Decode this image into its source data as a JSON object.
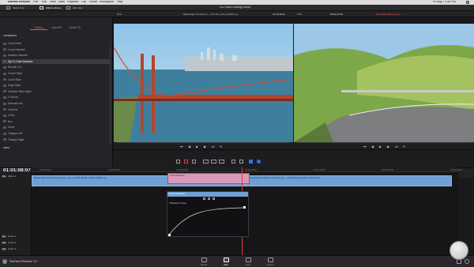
{
  "menubar": {
    "app": "DaVinci Resolve",
    "items": [
      "File",
      "Edit",
      "View",
      "Mark",
      "Playback",
      "Clip",
      "Nodes",
      "Workspace",
      "Help"
    ],
    "clock": "Fri Aug 7  4:44 PM"
  },
  "window": {
    "title": "912 NAB Editing Demo",
    "left_tabs": [
      "Media Pool",
      "Effects Library",
      "Edit Index"
    ]
  },
  "source_viewer": {
    "zoom": "57%",
    "clip_name": "Blackmagic Production ...2-03-19_1426_C0005.mov",
    "timecode": "14:26:30:01"
  },
  "program_viewer": {
    "zoom": "57%",
    "timecode": "00:03:19:19",
    "timeline_name": "912 NAB Editing Demo"
  },
  "effects": {
    "tabs": [
      "Toolbox",
      "OpenFX",
      "Audio FX"
    ],
    "section": "Transitions",
    "items": [
      "Cross Fade",
      "Cross Dissolve",
      "Additive Dissolve",
      "Dip To Color Dissolve",
      "Smooth Cut",
      "Center Wipe",
      "Clock Wipe",
      "Edge Wipe",
      "Venetian Blind Wipe",
      "X Iris Iris",
      "Diamond Iris",
      "Oval Iris",
      "X Box",
      "Box",
      "Heart",
      "Triangle Left",
      "Triangle Right"
    ],
    "selected_index": 3,
    "footer": "Titles"
  },
  "timeline": {
    "timecode": "01:01:08:07",
    "ruler_ticks": [
      "01:00:00:00",
      "01:00:30:00",
      "01:01:00:00",
      "01:01:15:00",
      "01:01:30:00",
      "01:01:45:00",
      "01:02:00:00"
    ],
    "tracks": {
      "video": [
        {
          "name": "Video 1"
        }
      ],
      "audio": [
        {
          "name": "Audio 1"
        },
        {
          "name": "Audio 2"
        },
        {
          "name": "Audio 3"
        }
      ]
    },
    "clips": [
      {
        "label": "Blackmagic Production Camera 4K_1_2015-03-19_1426_C0005.mov"
      },
      {
        "label": "Blackmagic Production Camera 4K_1_2015-03-19_1426_C0010.mov"
      }
    ],
    "transition_label": "Cross Dissolve"
  },
  "curve_panel": {
    "title": "Cross Dissolve",
    "label": "Transition Curve"
  },
  "bottom": {
    "app_label": "DaVinci Resolve 12",
    "pages": [
      "Media",
      "Edit",
      "Color",
      "Deliver"
    ],
    "active_page": "Edit"
  },
  "colors": {
    "accent": "#e0663a",
    "clip_blue": "#6f9fd3",
    "playhead": "#e23b3b"
  }
}
